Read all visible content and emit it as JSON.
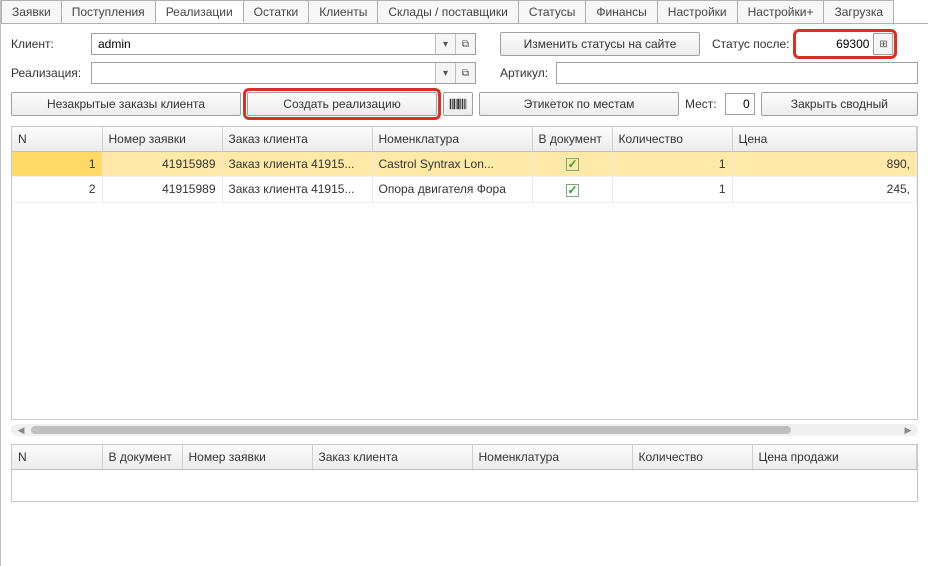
{
  "tabs": [
    "Заявки",
    "Поступления",
    "Реализации",
    "Остатки",
    "Клиенты",
    "Склады / поставщики",
    "Статусы",
    "Финансы",
    "Настройки",
    "Настройки+",
    "Загрузка"
  ],
  "activeTab": 2,
  "row1": {
    "client_label": "Клиент:",
    "client_value": "admin",
    "change_status_btn": "Изменить статусы на сайте",
    "status_after_label": "Статус после:",
    "status_after_value": "69300"
  },
  "row2": {
    "real_label": "Реализация:",
    "real_value": "",
    "article_label": "Артикул:",
    "article_value": ""
  },
  "row3": {
    "open_orders_btn": "Незакрытые заказы клиента",
    "create_real_btn": "Создать реализацию",
    "labels_btn": "Этикеток по местам",
    "places_label": "Мест:",
    "places_value": "0",
    "close_summary_btn": "Закрыть сводный"
  },
  "table1": {
    "headers": [
      "N",
      "Номер заявки",
      "Заказ клиента",
      "Номенклатура",
      "В документ",
      "Количество",
      "Цена"
    ],
    "rows": [
      {
        "n": "1",
        "order": "41915989",
        "client_order": "Заказ клиента 41915...",
        "nomen": "Castrol  Syntrax  Lon...",
        "in_doc": true,
        "qty": "1",
        "price": "890,"
      },
      {
        "n": "2",
        "order": "41915989",
        "client_order": "Заказ клиента 41915...",
        "nomen": "Опора двигателя Фора",
        "in_doc": true,
        "qty": "1",
        "price": "245,"
      }
    ]
  },
  "table2": {
    "headers": [
      "N",
      "В документ",
      "Номер заявки",
      "Заказ клиента",
      "Номенклатура",
      "Количество",
      "Цена продажи"
    ]
  }
}
